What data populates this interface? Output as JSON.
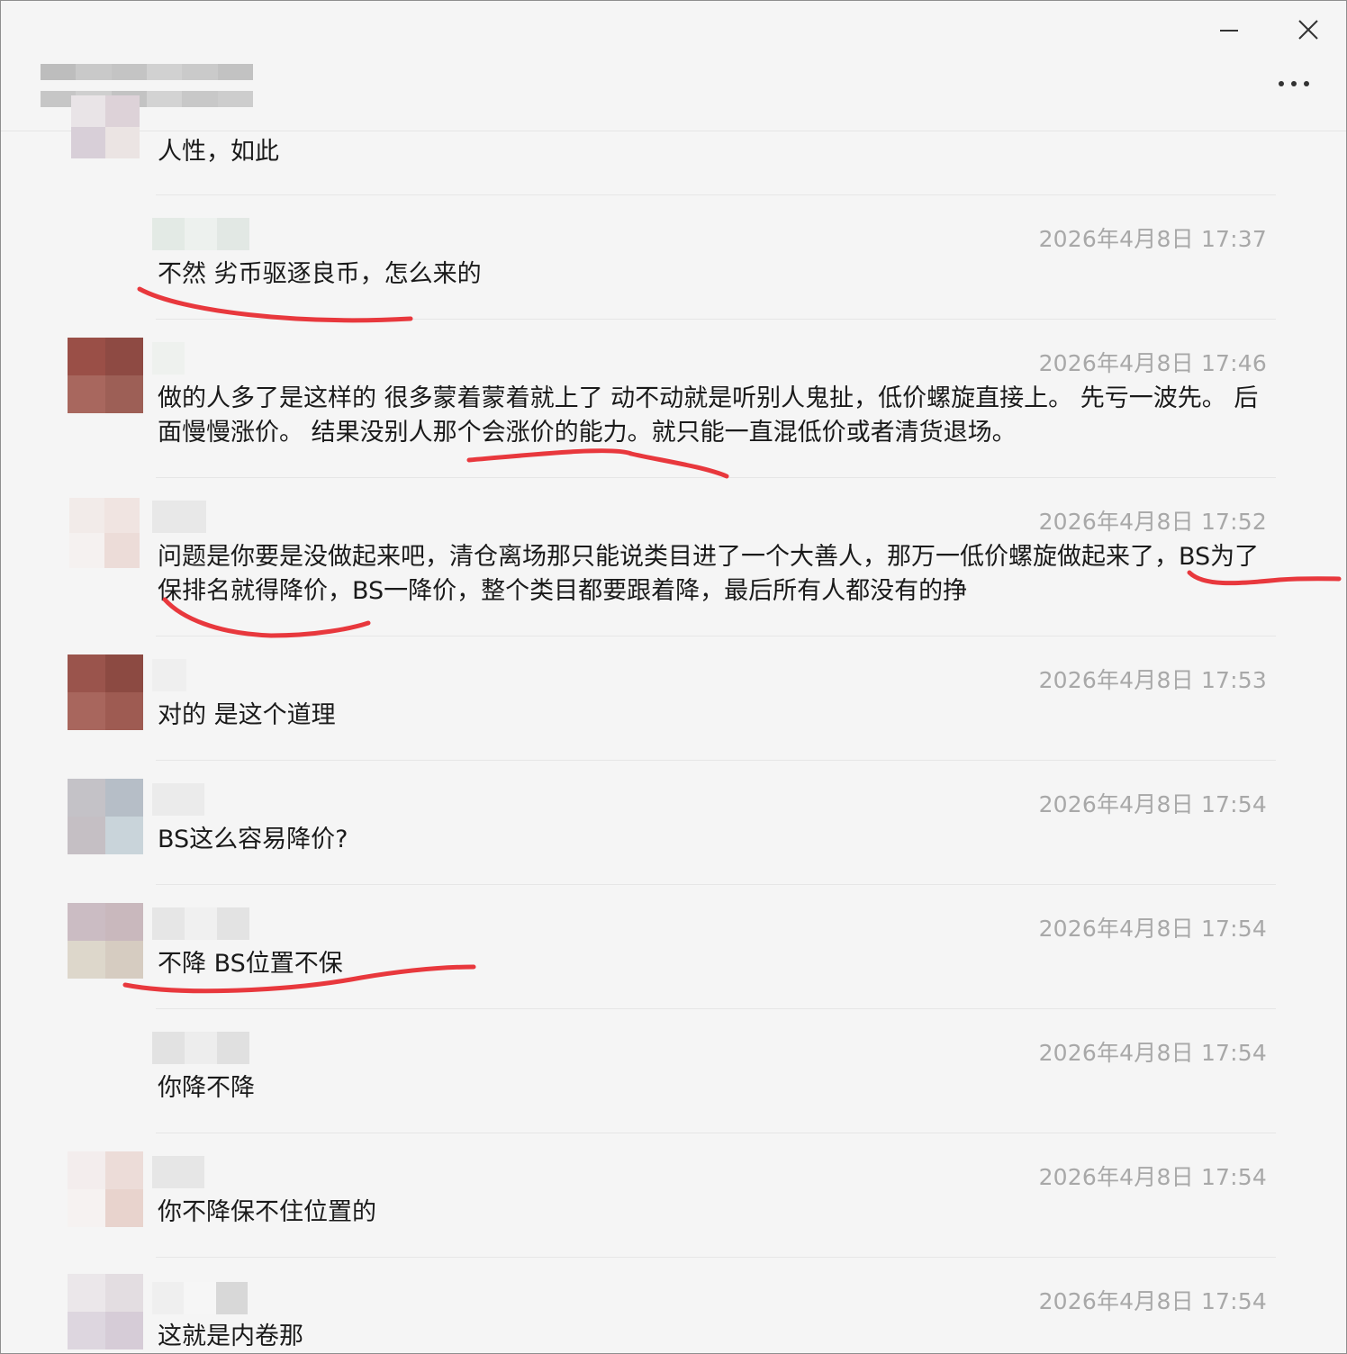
{
  "window": {
    "title_lines": [
      "",
      ""
    ],
    "controls": {
      "minimize": "minimize",
      "close": "close",
      "more": "more"
    }
  },
  "messages": [
    {
      "text": "人性，如此",
      "time": ""
    },
    {
      "text": "不然 劣币驱逐良币，怎么来的",
      "time": "2026年4月8日 17:37"
    },
    {
      "text": "做的人多了是这样的      很多蒙着蒙着就上了  动不动就是听别人鬼扯，低价螺旋直接上。 先亏一波先。 后面慢慢涨价。  结果没别人那个会涨价的能力。就只能一直混低价或者清货退场。",
      "time": "2026年4月8日 17:46"
    },
    {
      "text": "问题是你要是没做起来吧，清仓离场那只能说类目进了一个大善人，那万一低价螺旋做起来了，BS为了保排名就得降价，BS一降价，整个类目都要跟着降，最后所有人都没有的挣",
      "time": "2026年4月8日 17:52"
    },
    {
      "text": "对的  是这个道理",
      "time": "2026年4月8日 17:53"
    },
    {
      "text": "BS这么容易降价?",
      "time": "2026年4月8日 17:54"
    },
    {
      "text": "不降 BS位置不保",
      "time": "2026年4月8日 17:54"
    },
    {
      "text": "你降不降",
      "time": "2026年4月8日 17:54"
    },
    {
      "text": "你不降保不住位置的",
      "time": "2026年4月8日 17:54"
    },
    {
      "text": "这就是内卷那",
      "time": "2026年4月8日 17:54"
    }
  ],
  "colors": {
    "annotation_ink": "#e8383d",
    "timestamp": "#a8a8a8",
    "text": "#1a1a1a",
    "background": "#f5f5f5"
  },
  "icons": [
    "minimize-icon",
    "close-icon",
    "more-icon"
  ]
}
